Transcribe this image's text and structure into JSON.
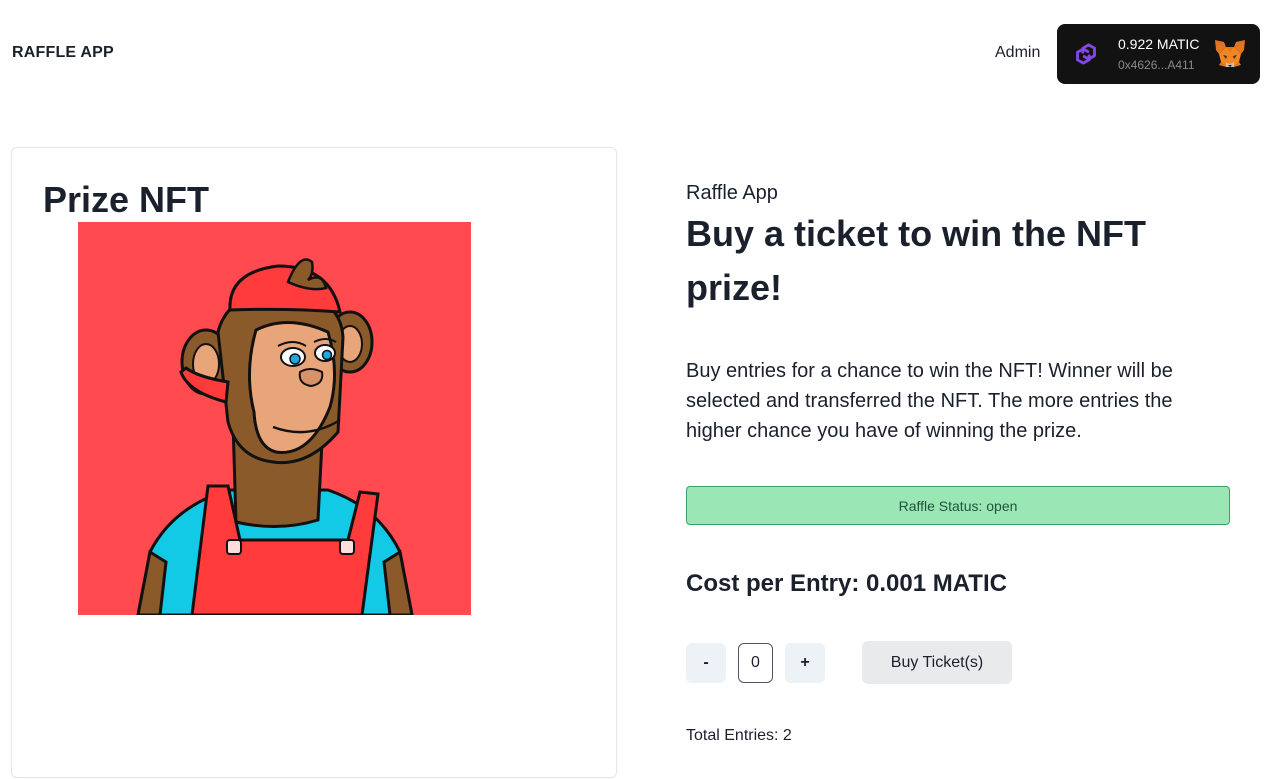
{
  "header": {
    "brand": "RAFFLE APP",
    "admin_label": "Admin",
    "wallet": {
      "balance": "0.922 MATIC",
      "address": "0x4626...A411",
      "chain_icon": "polygon-icon",
      "wallet_icon": "metamask-fox-icon"
    }
  },
  "prize": {
    "title": "Prize NFT",
    "image_icon": "bored-ape-nft-image",
    "background_color": "#ff4a50"
  },
  "main": {
    "eyebrow": "Raffle App",
    "headline": "Buy a ticket to win the NFT prize!",
    "description": "Buy entries for a chance to win the NFT! Winner will be selected and transferred the NFT. The more entries the higher chance you have of winning the prize.",
    "status": "Raffle Status: open",
    "status_color": "#9ae6b4",
    "cost": "Cost per Entry: 0.001 MATIC",
    "decrement_label": "-",
    "quantity": "0",
    "increment_label": "+",
    "buy_label": "Buy Ticket(s)",
    "total_entries": "Total Entries: 2"
  }
}
